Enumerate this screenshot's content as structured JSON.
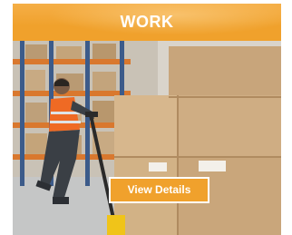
{
  "card": {
    "title": "WORK",
    "image_alt": "Warehouse worker pulling a pallet jack between storage racks",
    "cta_label": "View Details"
  },
  "colors": {
    "accent": "#f0a12c",
    "text_on_accent": "#ffffff"
  }
}
